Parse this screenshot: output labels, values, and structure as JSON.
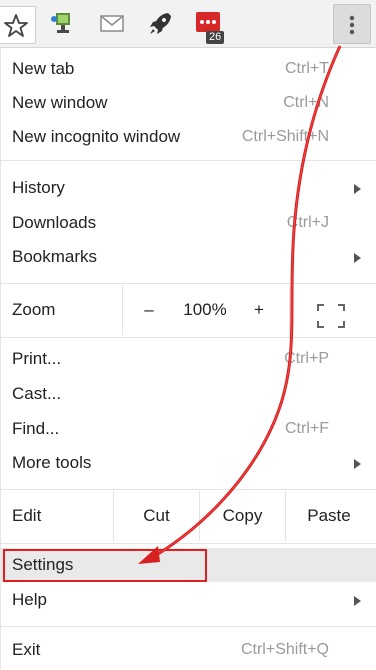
{
  "toolbar": {
    "star_icon": "star-outline-icon",
    "icons": [
      "extension-monitor-icon",
      "mail-icon",
      "rocket-icon",
      "red-chat-extension-icon"
    ],
    "badge_count": "26",
    "menu_icon": "three-dot-vertical-icon"
  },
  "menu": {
    "new_tab": {
      "label": "New tab",
      "shortcut": "Ctrl+T"
    },
    "new_window": {
      "label": "New window",
      "shortcut": "Ctrl+N"
    },
    "new_incognito": {
      "label": "New incognito window",
      "shortcut": "Ctrl+Shift+N"
    },
    "history": {
      "label": "History"
    },
    "downloads": {
      "label": "Downloads",
      "shortcut": "Ctrl+J"
    },
    "bookmarks": {
      "label": "Bookmarks"
    },
    "zoom": {
      "label": "Zoom",
      "minus": "–",
      "value": "100%",
      "plus": "+",
      "fullscreen_icon": "fullscreen-icon"
    },
    "print": {
      "label": "Print...",
      "shortcut": "Ctrl+P"
    },
    "cast": {
      "label": "Cast..."
    },
    "find": {
      "label": "Find...",
      "shortcut": "Ctrl+F"
    },
    "more_tools": {
      "label": "More tools"
    },
    "edit": {
      "label": "Edit",
      "cut": "Cut",
      "copy": "Copy",
      "paste": "Paste"
    },
    "settings": {
      "label": "Settings"
    },
    "help": {
      "label": "Help"
    },
    "exit": {
      "label": "Exit",
      "shortcut": "Ctrl+Shift+Q"
    }
  },
  "annotation": {
    "color": "#e02020"
  }
}
